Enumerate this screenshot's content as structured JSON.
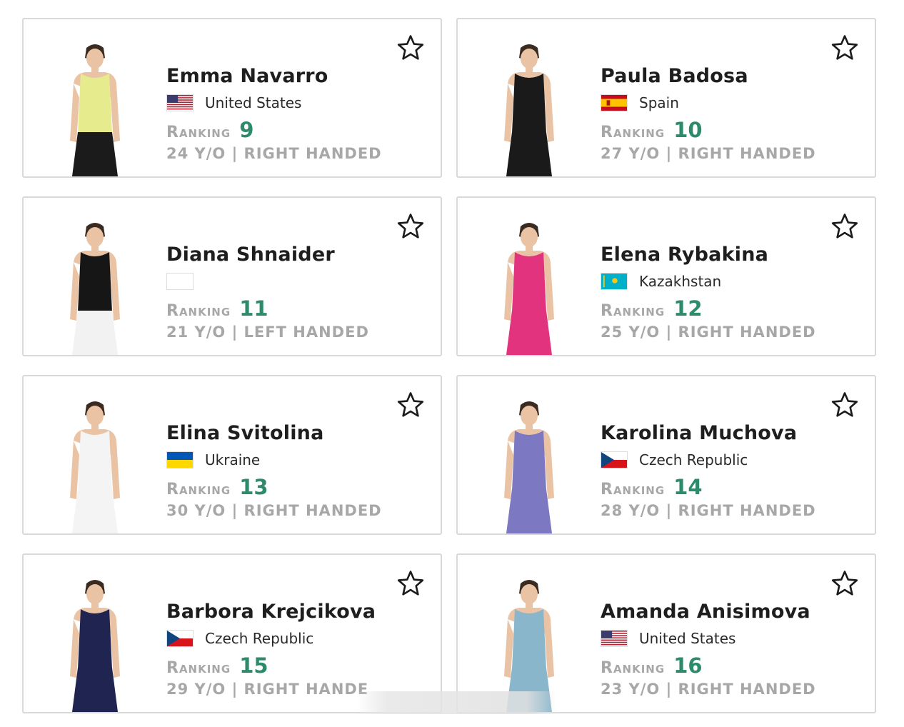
{
  "players": [
    {
      "name": "Emma Navarro",
      "country": "United States",
      "flag": "us",
      "ranking_label": "Ranking",
      "ranking": "9",
      "meta": "24 Y/O | RIGHT HANDED",
      "outfit": "#e6ec8e",
      "skirt": "#1b1b1b"
    },
    {
      "name": "Paula Badosa",
      "country": "Spain",
      "flag": "es",
      "ranking_label": "Ranking",
      "ranking": "10",
      "meta": "27 Y/O | RIGHT HANDED",
      "outfit": "#1a1a1a",
      "skirt": "#1a1a1a"
    },
    {
      "name": "Diana Shnaider",
      "country": "",
      "flag": "blank",
      "ranking_label": "Ranking",
      "ranking": "11",
      "meta": "21 Y/O | LEFT HANDED",
      "outfit": "#161616",
      "skirt": "#f2f2f2"
    },
    {
      "name": "Elena Rybakina",
      "country": "Kazakhstan",
      "flag": "kz",
      "ranking_label": "Ranking",
      "ranking": "12",
      "meta": "25 Y/O | RIGHT HANDED",
      "outfit": "#e2337f",
      "skirt": "#e2337f"
    },
    {
      "name": "Elina Svitolina",
      "country": "Ukraine",
      "flag": "ua",
      "ranking_label": "Ranking",
      "ranking": "13",
      "meta": "30 Y/O | RIGHT HANDED",
      "outfit": "#f4f4f4",
      "skirt": "#f4f4f4"
    },
    {
      "name": "Karolina Muchova",
      "country": "Czech Republic",
      "flag": "cz",
      "ranking_label": "Ranking",
      "ranking": "14",
      "meta": "28 Y/O | RIGHT HANDED",
      "outfit": "#7c78c2",
      "skirt": "#7c78c2"
    },
    {
      "name": "Barbora Krejcikova",
      "country": "Czech Republic",
      "flag": "cz",
      "ranking_label": "Ranking",
      "ranking": "15",
      "meta": "29 Y/O | RIGHT HANDE",
      "outfit": "#1f2550",
      "skirt": "#1f2550"
    },
    {
      "name": "Amanda Anisimova",
      "country": "United States",
      "flag": "us",
      "ranking_label": "Ranking",
      "ranking": "16",
      "meta": "23 Y/O | RIGHT HANDED",
      "outfit": "#8ab6cc",
      "skirt": "#8ab6cc"
    }
  ],
  "icons": {
    "favorite": "star-outline-icon"
  },
  "colors": {
    "ranking_number": "#2d8a6a",
    "muted_label": "#a7a7a7",
    "card_border": "#d9d9d9"
  }
}
